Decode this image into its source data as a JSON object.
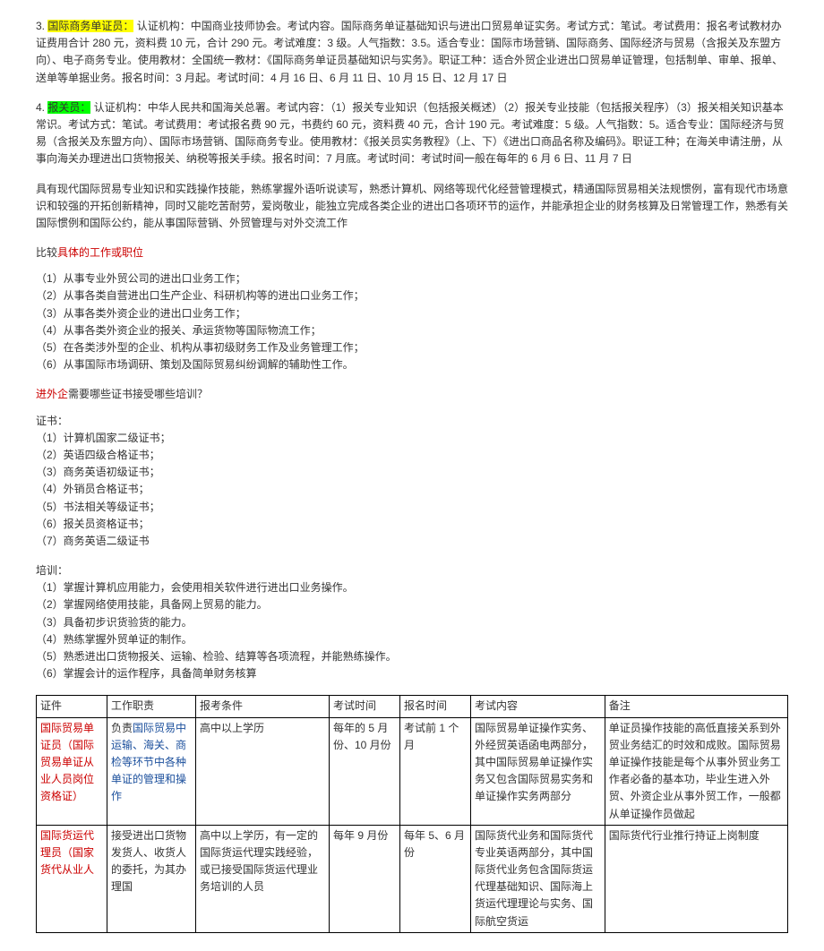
{
  "section3": {
    "num": "3.",
    "title": "国际商务单证员：",
    "body": "认证机构：中国商业技师协会。考试内容。国际商务单证基础知识与进出口贸易单证实务。考试方式：笔试。考试费用：报名考试教材办证费用合计 280 元，资料费 10 元，合计 290 元。考试难度：3 级。人气指数：3.5。适合专业：国际市场营销、国际商务、国际经济与贸易（含报关及东盟方向）、电子商务专业。使用教材：全国统一教材：《国际商务单证员基础知识与实务》。职证工种：适合外贸企业进出口贸易单证管理，包括制单、审单、报单、送单等单据业务。报名时间：3 月起。考试时间：4 月 16 日、6 月 11 日、10 月 15 日、12 月 17 日"
  },
  "section4": {
    "num": "4.",
    "title": "报关员：",
    "body": "认证机构：中华人民共和国海关总署。考试内容：（1）报关专业知识（包括报关概述）（2）报关专业技能（包括报关程序）（3）报关相关知识基本常识。考试方式：笔试。考试费用：考试报名费 90 元，书费约 60 元，资料费 40 元，合计 190 元。考试难度：5 级。人气指数：5。适合专业：国际经济与贸易（含报关及东盟方向）、国际市场营销、国际商务专业。使用教材：《报关员实务教程》（上、下）《进出口商品名称及编码》。职证工种；在海关申请注册，从事向海关办理进出口货物报关、纳税等报关手续。报名时间：7 月底。考试时间：考试时间一般在每年的 6 月 6 日、11 月 7 日"
  },
  "para1": "具有现代国际贸易专业知识和实践操作技能，熟练掌握外语听说读写，熟悉计算机、网络等现代化经营管理模式，精通国际贸易相关法规惯例，富有现代市场意识和较强的开拓创新精神，同时又能吃苦耐劳，爱岗敬业，能独立完成各类企业的进出口各项环节的运作，并能承担企业的财务核算及日常管理工作，熟悉有关国际惯例和国际公约，能从事国际营销、外贸管理与对外交流工作",
  "positions": {
    "heading_prefix": "比较",
    "heading_red": "具体的工作或职位",
    "items": [
      "（1）从事专业外贸公司的进出口业务工作；",
      "（2）从事各类自营进出口生产企业、科研机构等的进出口业务工作；",
      "（3）从事各类外资企业的进出口业务工作；",
      "（4）从事各类外资企业的报关、承运货物等国际物流工作；",
      "（5）在各类涉外型的企业、机构从事初级财务工作及业务管理工作；",
      "（6）从事国际市场调研、策划及国际贸易纠纷调解的辅助性工作。"
    ]
  },
  "certs": {
    "heading_red": "进外企",
    "heading_rest": "需要哪些证书接受哪些培训？",
    "sub1": "证书：",
    "items": [
      "（1）计算机国家二级证书；",
      "（2）英语四级合格证书；",
      "（3）商务英语初级证书；",
      "（4）外销员合格证书；",
      "（5）书法相关等级证书；",
      "（6）报关员资格证书；",
      "（7）商务英语二级证书"
    ]
  },
  "training": {
    "heading": "培训：",
    "items": [
      "（1）掌握计算机应用能力，会使用相关软件进行进出口业务操作。",
      "（2）掌握网络使用技能，具备网上贸易的能力。",
      "（3）具备初步识货验货的能力。",
      "（4）熟练掌握外贸单证的制作。",
      "（5）熟悉进出口货物报关、运输、检验、结算等各项流程，并能熟练操作。",
      "（6）掌握会计的运作程序，具备简单财务核算"
    ]
  },
  "table": {
    "headers": [
      "证件",
      "工作职责",
      "报考条件",
      "考试时间",
      "报名时间",
      "考试内容",
      "备注"
    ],
    "rows": [
      {
        "c0": "国际贸易单证员（国际贸易单证从业人员岗位资格证）",
        "c1_prefix": "负责",
        "c1_blue": "国际贸易中运输、海关、商检等环节中各种单证的管理和操作",
        "c2": "高中以上学历",
        "c3": "每年的 5 月份、10 月份",
        "c4": "考试前 1 个月",
        "c5": "国际贸易单证操作实务、外经贸英语函电两部分，其中国际贸易单证操作实务又包含国际贸易实务和单证操作实务两部分",
        "c6": "单证员操作技能的高低直接关系到外贸业务结汇的时效和成败。国际贸易单证操作技能是每个从事外贸业务工作者必备的基本功，毕业生进入外贸、外资企业从事外贸工作，一般都从单证操作员做起"
      },
      {
        "c0": "国际货运代理员（国家货代从业人",
        "c1": "接受进出口货物发货人、收货人的委托，为其办理国",
        "c2": "高中以上学历，有一定的国际货运代理实践经验，或已接受国际货运代理业务培训的人员",
        "c3": "每年 9 月份",
        "c4": "每年 5、6 月份",
        "c5": "国际货代业务和国际货代专业英语两部分，其中国际货代业务包含国际货运代理基础知识、国际海上货运代理理论与实务、国际航空货运",
        "c6": "国际货代行业推行持证上岗制度"
      }
    ]
  }
}
